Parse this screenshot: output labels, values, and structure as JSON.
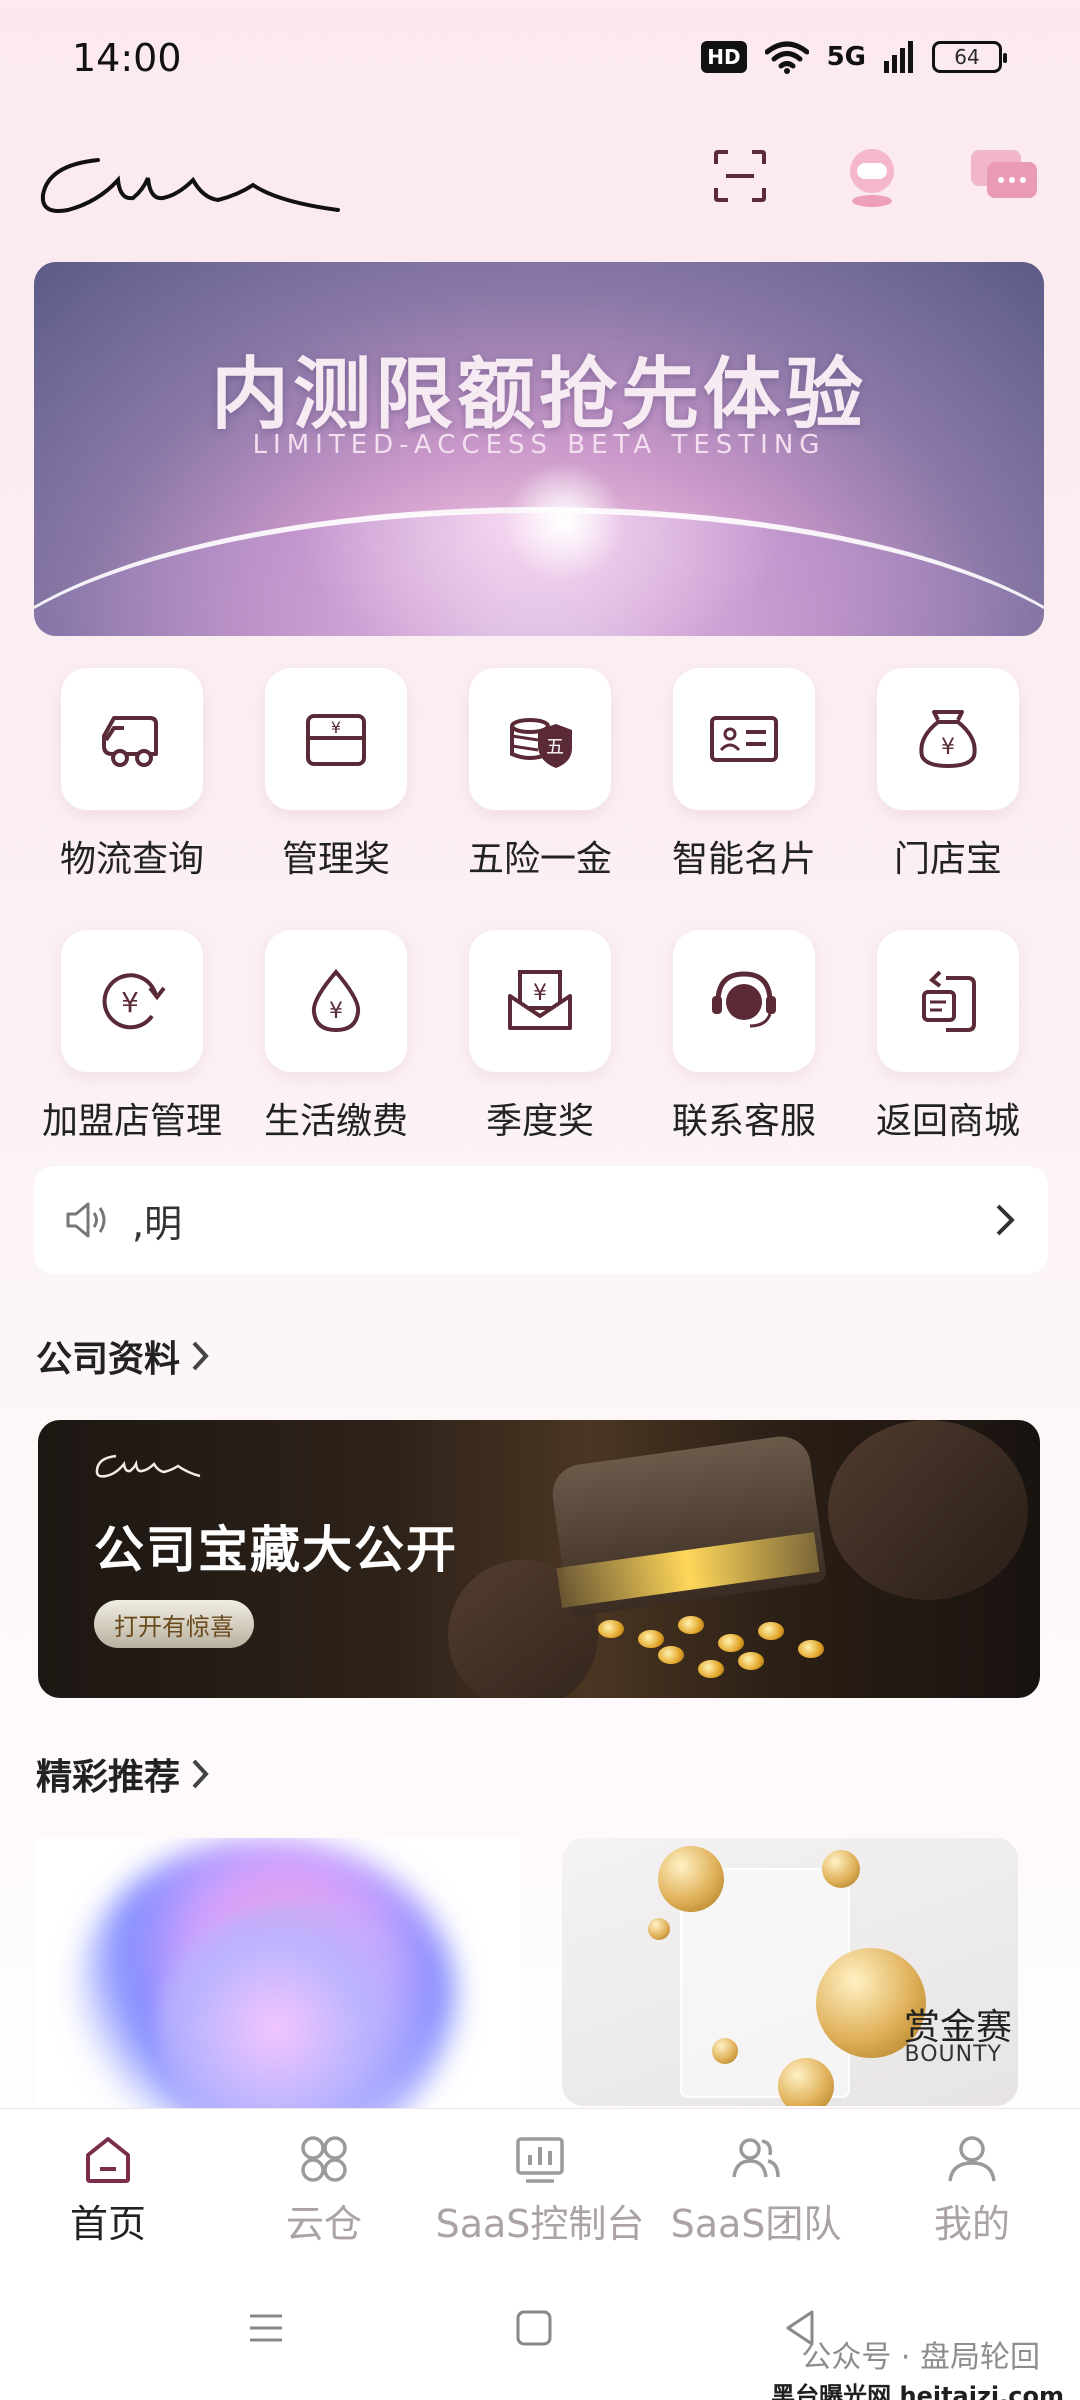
{
  "status": {
    "time": "14:00",
    "hd": "HD",
    "network": "5G",
    "battery": "64"
  },
  "banner": {
    "title": "内测限额抢先体验",
    "subtitle": "LIMITED-ACCESS BETA TESTING"
  },
  "grid": [
    {
      "label": "物流查询",
      "icon": "truck-icon"
    },
    {
      "label": "管理奖",
      "icon": "wallet-icon"
    },
    {
      "label": "五险一金",
      "icon": "coin-stack-icon"
    },
    {
      "label": "智能名片",
      "icon": "business-card-icon"
    },
    {
      "label": "门店宝",
      "icon": "money-bag-icon"
    },
    {
      "label": "加盟店管理",
      "icon": "yen-refresh-icon"
    },
    {
      "label": "生活缴费",
      "icon": "yen-drop-icon"
    },
    {
      "label": "季度奖",
      "icon": "yen-envelope-icon"
    },
    {
      "label": "联系客服",
      "icon": "headset-icon"
    },
    {
      "label": "返回商城",
      "icon": "return-icon"
    }
  ],
  "notice": {
    "text": ",明"
  },
  "sections": {
    "company": "公司资料",
    "recommend": "精彩推荐"
  },
  "company_banner": {
    "title": "公司宝藏大公开",
    "button": "打开有惊喜"
  },
  "recommend": {
    "right_title": "赏金赛",
    "right_sub": "BOUNTY"
  },
  "tabs": [
    {
      "label": "首页",
      "icon": "home-icon",
      "active": true
    },
    {
      "label": "云仓",
      "icon": "grid-circles-icon",
      "active": false
    },
    {
      "label": "SaaS控制台",
      "icon": "chart-icon",
      "active": false
    },
    {
      "label": "SaaS团队",
      "icon": "team-icon",
      "active": false
    },
    {
      "label": "我的",
      "icon": "profile-icon",
      "active": false
    }
  ],
  "watermark": {
    "line1": "公众号 · 盘局轮回",
    "line2": "黑台曝光网 heitaizi.com"
  },
  "colors": {
    "accent": "#7a2e4b",
    "icon": "#5a2a36"
  }
}
